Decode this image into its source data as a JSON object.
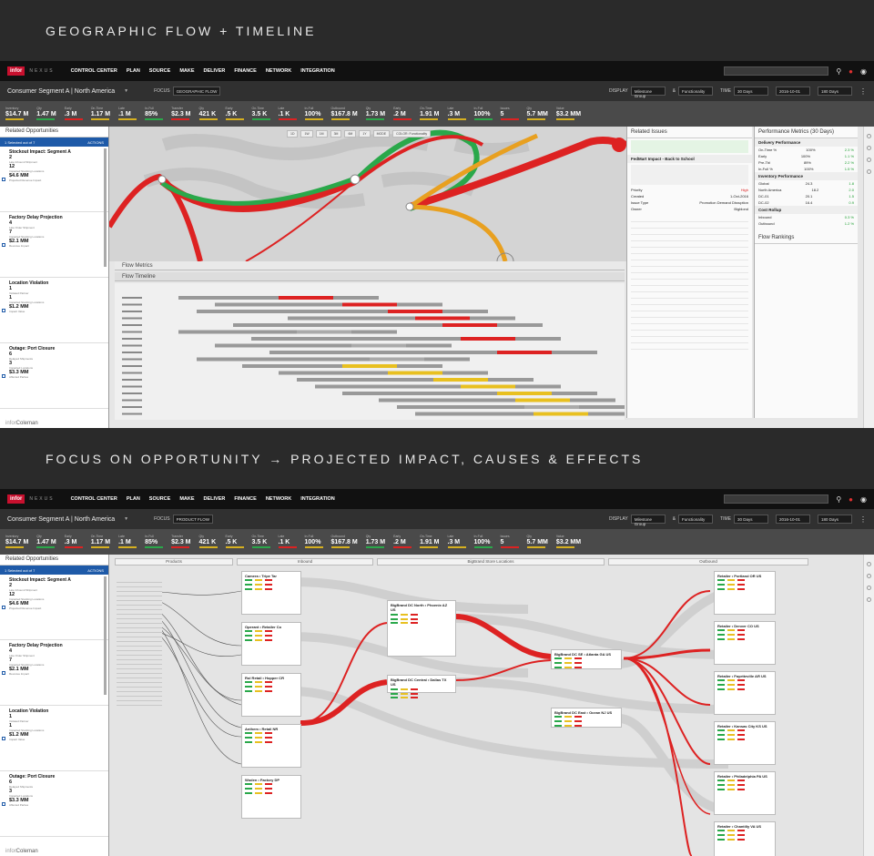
{
  "sections": [
    {
      "title": "GEOGRAPHIC FLOW + TIMELINE"
    },
    {
      "title": "FOCUS ON OPPORTUNITY → PROJECTED IMPACT, CAUSES & EFFECTS"
    }
  ],
  "app": {
    "logo": "infor",
    "brand": "NEXUS",
    "nav": [
      "CONTROL CENTER",
      "PLAN",
      "SOURCE",
      "MAKE",
      "DELIVER",
      "FINANCE",
      "NETWORK",
      "INTEGRATION"
    ]
  },
  "subbar": {
    "segment": "Consumer Segment A | North America",
    "focus_label": "FOCUS",
    "view1_mode": "GEOGRAPHIC FLOW",
    "view2_mode": "PRODUCT FLOW",
    "display_label": "DISPLAY",
    "display_value": "Milestone Group",
    "by_label": "&",
    "by_value": "Functionality",
    "time_label": "TIME",
    "time_value": "30 Days",
    "date_value": "2016-10-01",
    "range_value": "180 Days"
  },
  "kpis": {
    "view1": [
      {
        "l": "Inventory",
        "v": "$14.7 M"
      },
      {
        "l": "Qty",
        "v": "1.47 M"
      },
      {
        "l": "Early",
        "v": ".3 M"
      },
      {
        "l": "On-Time",
        "v": "1.17 M"
      },
      {
        "l": "Late",
        "v": ".1 M"
      },
      {
        "l": "In-Full",
        "v": "85%"
      },
      {
        "l": "Transfer",
        "v": "$2.3 M"
      },
      {
        "l": "Qty",
        "v": "421 K"
      },
      {
        "l": "Early",
        "v": ".5 K"
      },
      {
        "l": "On-Time",
        "v": "3.5 K"
      },
      {
        "l": "Late",
        "v": ".1 K"
      },
      {
        "l": "In-Full",
        "v": "100%"
      },
      {
        "l": "Outbound",
        "v": "$167.8 M"
      },
      {
        "l": "Qty",
        "v": "1.73 M"
      },
      {
        "l": "Early",
        "v": ".2 M"
      },
      {
        "l": "On-Time",
        "v": "1.91 M"
      },
      {
        "l": "Late",
        "v": ".3 M"
      },
      {
        "l": "In-Full",
        "v": "100%"
      },
      {
        "l": "Issues",
        "v": "5"
      },
      {
        "l": "Qty",
        "v": "5.7 MM"
      },
      {
        "l": "Value",
        "v": "$3.2 MM"
      }
    ],
    "view2": [
      {
        "l": "Inventory",
        "v": "$14.7 M"
      },
      {
        "l": "Qty",
        "v": "1.47 M"
      },
      {
        "l": "Early",
        "v": ".3 M"
      },
      {
        "l": "On-Time",
        "v": "1.17 M"
      },
      {
        "l": "Late",
        "v": ".1 M"
      },
      {
        "l": "In-Full",
        "v": "85%"
      },
      {
        "l": "Transfer",
        "v": "$2.3 M"
      },
      {
        "l": "Qty",
        "v": "421 K"
      },
      {
        "l": "Early",
        "v": ".5 K"
      },
      {
        "l": "On-Time",
        "v": "3.5 K"
      },
      {
        "l": "Late",
        "v": ".1 K"
      },
      {
        "l": "In-Full",
        "v": "100%"
      },
      {
        "l": "Outbound",
        "v": "$167.8 M"
      },
      {
        "l": "Qty",
        "v": "1.73 M"
      },
      {
        "l": "Early",
        "v": ".2 M"
      },
      {
        "l": "On-Time",
        "v": "1.91 M"
      },
      {
        "l": "Late",
        "v": ".3 M"
      },
      {
        "l": "In-Full",
        "v": "100%"
      },
      {
        "l": "Issues",
        "v": "5"
      },
      {
        "l": "Qty",
        "v": "5.7 MM"
      },
      {
        "l": "Value",
        "v": "$3.2 MM"
      }
    ]
  },
  "left": {
    "title": "Related Opportunities",
    "selected": "1 Selected out of 7",
    "actions": "ACTIONS",
    "items": [
      {
        "title": "Stockout Impact: Segment A",
        "n1": "2",
        "s1": "Late Inbound Shipment",
        "n2": "12",
        "s2": "Impacted Stocking Locations",
        "n3": "$4.6 MM",
        "s3": "Projected Revenue Impact"
      },
      {
        "title": "Factory Delay Projection",
        "n1": "4",
        "s1": "Late Order Shipment",
        "n2": "7",
        "s2": "Impacted Stocking Locations",
        "n3": "$2.1 MM",
        "s3": "Revenue Impact"
      },
      {
        "title": "Location Violation",
        "n1": "1",
        "s1": "Violated Partner",
        "n2": "1",
        "s2": "Impacted Stocking Locations",
        "n3": "$1.2 MM",
        "s3": "Impact Value"
      },
      {
        "title": "Outage: Port Closure",
        "n1": "6",
        "s1": "Delayed Shipments",
        "n2": "3",
        "s2": "Impacted Locations",
        "n3": "$3.3 MM",
        "s3": "Affected Parties"
      }
    ],
    "footer_a": "infor",
    "footer_b": "Coleman"
  },
  "view1": {
    "map_controls": [
      "1D",
      "1W",
      "1M",
      "3M",
      "6M",
      "1Y",
      "MODE",
      "COLOR: Functionality"
    ],
    "flow_metrics": "Flow Metrics",
    "flow_timeline": "Flow Timeline",
    "issues_title": "Related Issues",
    "issue_headline": "FedMart Impact - Back to School",
    "issue_rows": [
      [
        "Priority",
        "High"
      ],
      [
        "Created",
        "1-Oct-2016"
      ],
      [
        "Issue Type",
        "Promotion Demand Disruption"
      ],
      [
        "Owner",
        "Bigblond"
      ]
    ],
    "perf_title": "Performance Metrics (30 Days)",
    "perf_sections": [
      {
        "name": "Delivery Performance",
        "rows": [
          [
            "On-Time %",
            "100%",
            "2.3 %"
          ],
          [
            "Early",
            "100%",
            "1.1 %"
          ],
          [
            "Pre-Tbl",
            "89%",
            "2.2 %"
          ],
          [
            "In-Full %",
            "100%",
            "1.5 %"
          ]
        ]
      },
      {
        "name": "Inventory Performance",
        "rows": [
          [
            "Global",
            "24.3",
            "1.8"
          ],
          [
            "North America",
            "18.2",
            "2.0"
          ],
          [
            "DC-01",
            "20.1",
            "1.5"
          ],
          [
            "DC-02",
            "16.4",
            "0.9"
          ]
        ]
      },
      {
        "name": "Cost Rollup",
        "rows": [
          [
            "Inbound",
            "",
            "0.3 %"
          ],
          [
            "Outbound",
            "",
            "1.2 %"
          ]
        ]
      }
    ],
    "rankings": "Flow Rankings"
  },
  "view2": {
    "col_headers": [
      "Products",
      "Inbound",
      "BigBrand Store Locations",
      "Outbound"
    ],
    "inbound_cards": [
      "Camera • Tripe Tar",
      "Operant • Retailer Co",
      "Rol Retail • Hopper CR",
      "Anthem • Retail NR",
      "Woden • Factory DP"
    ],
    "dc_cards": [
      "BigBrand DC North • Phoenix AZ US",
      "BigBrand DC Central • Dallas TX US"
    ],
    "hub_cards": [
      "BigBrand DC SE • Atlanta GA US",
      "BigBrand DC East • Ocean NJ US"
    ],
    "outbound_cards": [
      "Retailer • Portland OR US",
      "Retailer • Denver CO US",
      "Retailer • Fayetteville AR US",
      "Retailer • Kansas City KS US",
      "Retailer • Philadelphia PA US",
      "Retailer • Chantilly VA US"
    ]
  }
}
